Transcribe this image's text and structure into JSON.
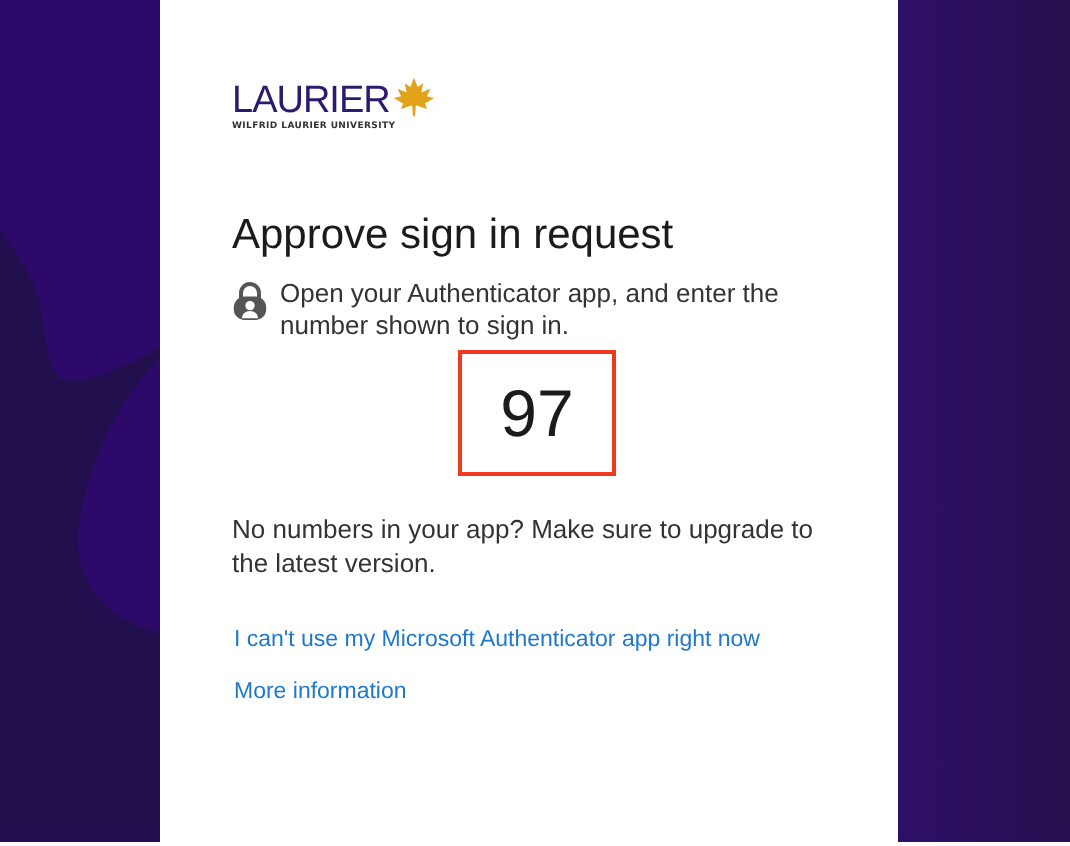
{
  "logo": {
    "wordmark": "LAURIER",
    "tagline": "WILFRID LAURIER UNIVERSITY"
  },
  "title": "Approve sign in request",
  "instruction": "Open your Authenticator app, and enter the number shown to sign in.",
  "number": "97",
  "note": "No numbers in your app? Make sure to upgrade to the latest version.",
  "links": [
    "I can't use my Microsoft Authenticator app right now",
    "More information"
  ]
}
